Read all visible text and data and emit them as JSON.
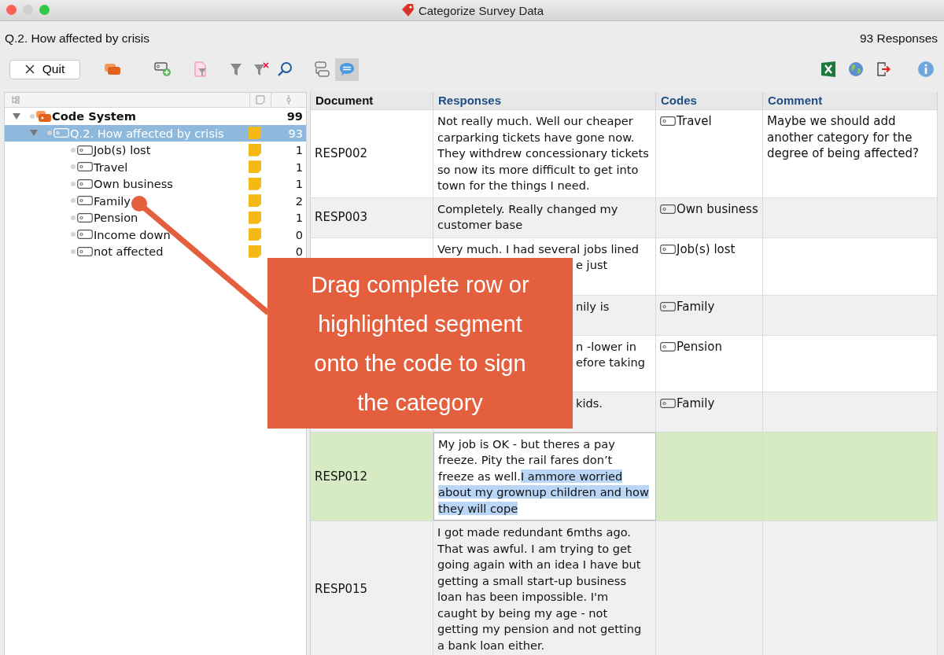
{
  "window": {
    "title": "Categorize Survey Data"
  },
  "header": {
    "question": "Q.2. How affected by crisis",
    "responses_count": "93 Responses"
  },
  "toolbar": {
    "quit_label": "Quit"
  },
  "code_tree": {
    "root": {
      "name": "Code System",
      "count": "99",
      "expanded": true,
      "selected": false,
      "children": [
        {
          "name": "Q.2. How affected by crisis",
          "count": "93",
          "expanded": true,
          "selected": true,
          "children": [
            {
              "name": "Job(s) lost",
              "count": "1",
              "selected": false
            },
            {
              "name": "Travel",
              "count": "1",
              "selected": false
            },
            {
              "name": "Own business",
              "count": "1",
              "selected": false
            },
            {
              "name": "Family",
              "count": "2",
              "selected": false
            },
            {
              "name": "Pension",
              "count": "1",
              "selected": false
            },
            {
              "name": "Income down",
              "count": "0",
              "selected": false
            },
            {
              "name": "not affected",
              "count": "0",
              "selected": false
            }
          ]
        }
      ]
    }
  },
  "table": {
    "columns": [
      "Document",
      "Responses",
      "Codes",
      "Comment"
    ],
    "rows": [
      {
        "document": "RESP002",
        "response": "Not really much. Well our cheaper carparking tickets have gone now. They withdrew concessionary tickets so now its more difficult to get into town for the things I need.",
        "code": "Travel",
        "comment": "Maybe we should add another category for the degree of being affected?",
        "selected": false
      },
      {
        "document": "RESP003",
        "response": "Completely. Really changed my customer base",
        "code": "Own business",
        "selected": false
      },
      {
        "response_lines": [
          {
            "text": "Very much. I had several jobs lined",
            "covered": false
          },
          {
            "text": "e just",
            "covered": true
          }
        ],
        "code": "Job(s) lost",
        "selected": false
      },
      {
        "response_lines": [
          {
            "text": "nily is",
            "covered": true
          }
        ],
        "code": "Family",
        "selected": false
      },
      {
        "response_lines": [
          {
            "text": "n -lower in",
            "covered": true
          },
          {
            "text": "efore taking",
            "covered": true
          }
        ],
        "code": "Pension",
        "selected": false
      },
      {
        "response_lines": [
          {
            "text": "kids.",
            "covered": true
          }
        ],
        "code": "Family",
        "selected": false
      },
      {
        "document": "RESP012",
        "response": "My job is OK - but theres a pay freeze. Pity the rail fares don’t freeze as well.",
        "highlighted": "I ammore worried about my grownup children and how they will cope",
        "selected": true
      },
      {
        "document": "RESP015",
        "response": "I got made redundant 6mths ago. That was awful.  I am trying to get going again with an idea I have but getting a small start-up business loan has been impossible. I'm caught by being my age - not getting my pension and not getting a bank loan either.",
        "selected": false
      }
    ]
  },
  "callout": {
    "text": "Drag complete row or highlighted segment onto the code to sign the category"
  }
}
